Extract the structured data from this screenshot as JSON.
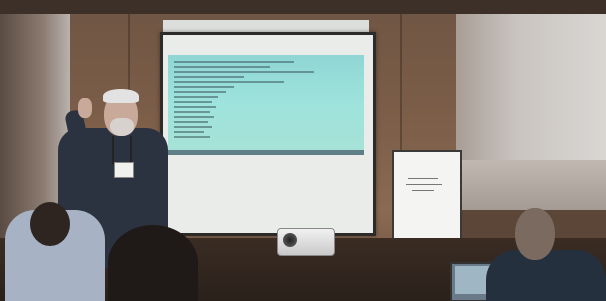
{
  "scene": {
    "kind": "photograph",
    "main_subject": "presenter",
    "objects": [
      "projection-screen",
      "projector",
      "flipchart",
      "audience",
      "laptop"
    ]
  },
  "colors": {
    "projected_screen": "#9ee3dc",
    "wood_panel": "#7c5e49",
    "speaker_shirt": "#2b3240"
  }
}
